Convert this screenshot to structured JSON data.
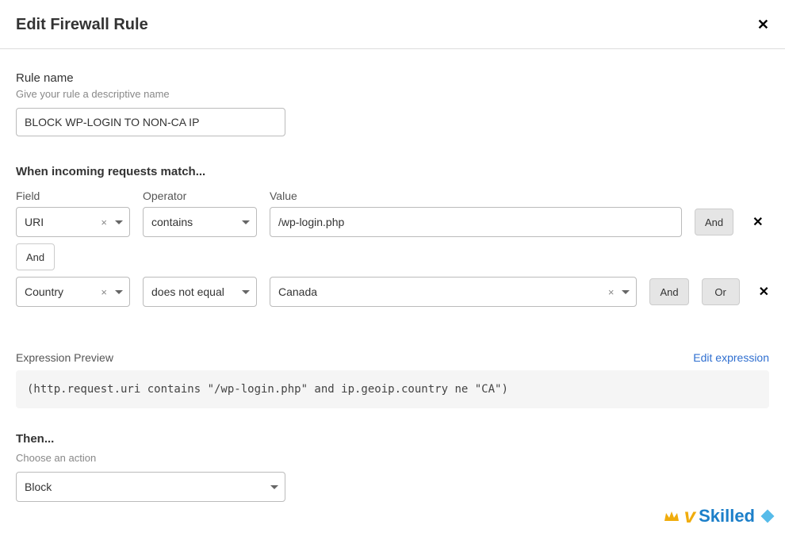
{
  "header": {
    "title": "Edit Firewall Rule"
  },
  "ruleName": {
    "label": "Rule name",
    "hint": "Give your rule a descriptive name",
    "value": "BLOCK WP-LOGIN TO NON-CA IP"
  },
  "match": {
    "title": "When incoming requests match...",
    "headers": {
      "field": "Field",
      "operator": "Operator",
      "value": "Value"
    },
    "rows": [
      {
        "field": "URI",
        "operator": "contains",
        "value": "/wp-login.php",
        "showClear": true,
        "valueIsSelect": false,
        "btns": [
          "And"
        ]
      },
      {
        "field": "Country",
        "operator": "does not equal",
        "value": "Canada",
        "showClear": true,
        "valueIsSelect": true,
        "btns": [
          "And",
          "Or"
        ]
      }
    ],
    "connector": "And",
    "andLabel": "And",
    "orLabel": "Or"
  },
  "expression": {
    "label": "Expression Preview",
    "editLink": "Edit expression",
    "text": "(http.request.uri contains \"/wp-login.php\" and ip.geoip.country ne \"CA\")"
  },
  "then": {
    "title": "Then...",
    "hint": "Choose an action",
    "action": "Block"
  },
  "watermark": "Skilled"
}
